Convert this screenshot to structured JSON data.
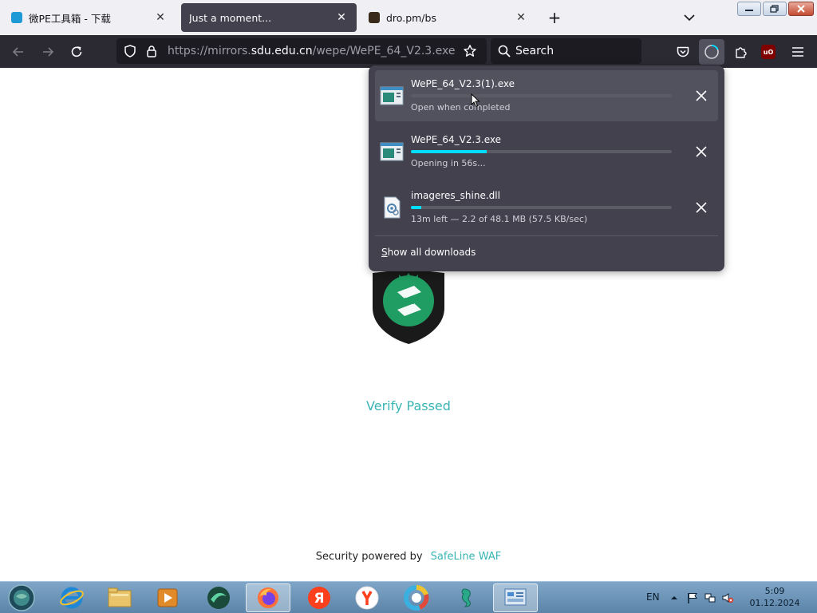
{
  "tabs": [
    {
      "title": "微PE工具箱 - 下载",
      "favicon_color": "#1e9ad6",
      "active": false
    },
    {
      "title": "Just a moment...",
      "active": true
    },
    {
      "title": "dro.pm/bs",
      "favicon_color": "#3a2a1a",
      "active": false
    }
  ],
  "nav": {
    "url_prefix": "https://mirrors.",
    "url_host": "sdu.edu.cn",
    "url_path": "/wepe/WePE_64_V2.3.exe",
    "search_placeholder": "Search",
    "ublock_label": "uO"
  },
  "downloads_panel": {
    "items": [
      {
        "filename": "WePE_64_V2.3(1).exe",
        "status": "Open when completed",
        "progress": 0,
        "highlighted": true
      },
      {
        "filename": "WePE_64_V2.3.exe",
        "status": "Opening in 56s...",
        "progress": 0.29,
        "highlighted": false
      },
      {
        "filename": "imageres_shine.dll",
        "status": "13m left — 2.2 of 48.1 MB (57.5 KB/sec)",
        "progress": 0.04,
        "highlighted": false
      }
    ],
    "show_all_label": "Show all downloads",
    "show_all_underline": "S",
    "show_all_rest": "how all downloads"
  },
  "page": {
    "verify_text": "Verify Passed",
    "footer_prefix": "Security powered by",
    "footer_link": "SafeLine WAF"
  },
  "taskbar": {
    "language": "EN",
    "time": "5:09",
    "date": "01.12.2024"
  },
  "colors": {
    "accent": "#39b5b5",
    "progress": "#00ddff",
    "shield_green": "#1f9d62"
  }
}
